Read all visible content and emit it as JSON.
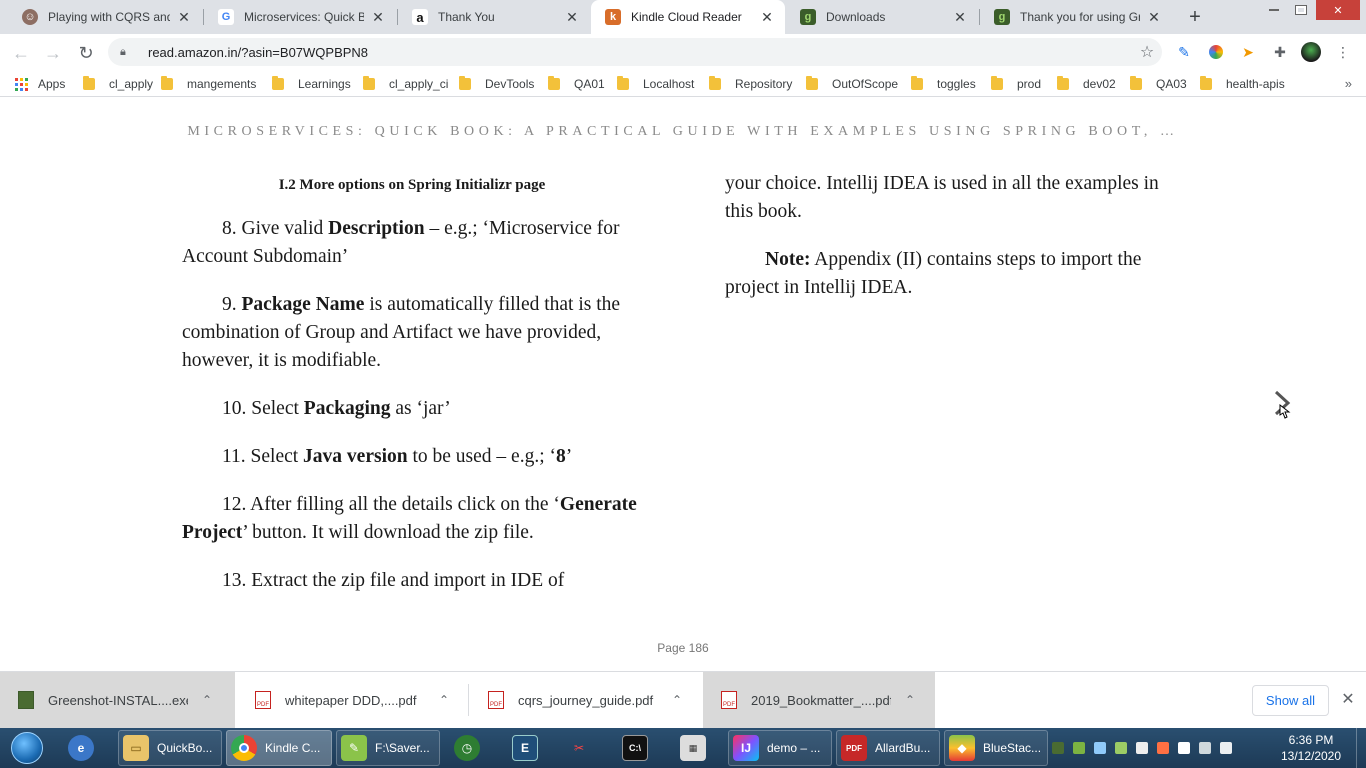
{
  "browser": {
    "tabs": [
      {
        "title": "Playing with CQRS and E",
        "icon": "avatar-icon"
      },
      {
        "title": "Microservices: Quick Boo",
        "icon": "google-icon"
      },
      {
        "title": "Thank You",
        "icon": "amazon-icon"
      },
      {
        "title": "Kindle Cloud Reader",
        "icon": "kindle-icon",
        "active": true
      },
      {
        "title": "Downloads",
        "icon": "greenshot-icon"
      },
      {
        "title": "Thank you for using Gree",
        "icon": "greenshot-icon"
      }
    ],
    "url": "read.amazon.in/?asin=B07WQPBPN8",
    "bookmarks": [
      "Apps",
      "cl_apply",
      "mangements",
      "Learnings",
      "cl_apply_ci",
      "DevTools",
      "QA01",
      "Localhost",
      "Repository",
      "OutOfScope",
      "toggles",
      "prod",
      "dev02",
      "QA03",
      "health-apis"
    ]
  },
  "reader": {
    "book_title": "MICROSERVICES: QUICK BOOK: A PRACTICAL GUIDE WITH EXAMPLES USING SPRING BOOT, …",
    "section_heading": "I.2 More options on Spring Initializr page",
    "left": {
      "p8_pre": "8. Give valid ",
      "p8_bold": "Description",
      "p8_post": " – e.g.; ‘Microservice for Account Subdomain’",
      "p9_pre": "9. ",
      "p9_bold": "Package Name",
      "p9_post": " is automatically filled that is the combination of Group and Artifact we have provided, however, it is modifiable.",
      "p10_pre": "10. Select ",
      "p10_bold": "Packaging",
      "p10_post": " as ‘jar’",
      "p11_pre": "11. Select ",
      "p11_bold": "Java version",
      "p11_mid": " to be used – e.g.; ‘",
      "p11_bold2": "8",
      "p11_post": "’",
      "p12_pre": "12. After filling all the details click on the ‘",
      "p12_bold": "Generate Project",
      "p12_post": "’ button. It will download the zip file.",
      "p13": "13. Extract the zip file and import in IDE of"
    },
    "right": {
      "p1": "your choice. Intellij IDEA is used in all the examples in this book.",
      "note_bold": "Note:",
      "note_post": " Appendix (II) contains steps to import the project in Intellij IDEA."
    },
    "page_label": "Page 186"
  },
  "downloads": {
    "items": [
      {
        "name": "Greenshot-INSTAL....exe",
        "type": "exe"
      },
      {
        "name": "whitepaper DDD,....pdf",
        "type": "pdf"
      },
      {
        "name": "cqrs_journey_guide.pdf",
        "type": "pdf"
      },
      {
        "name": "2019_Bookmatter_....pdf",
        "type": "pdf"
      }
    ],
    "show_all": "Show all"
  },
  "taskbar": {
    "items": [
      {
        "label": "",
        "icon": "explorer-icon"
      },
      {
        "label": "QuickBo...",
        "icon": "folder-icon"
      },
      {
        "label": "Kindle C...",
        "icon": "chrome-icon",
        "active": true
      },
      {
        "label": "F:\\Saver...",
        "icon": "notepadpp-icon"
      },
      {
        "label": "",
        "icon": "clock-app-icon"
      },
      {
        "label": "",
        "icon": "editor-icon"
      },
      {
        "label": "",
        "icon": "snipping-icon"
      },
      {
        "label": "",
        "icon": "cmd-icon"
      },
      {
        "label": "",
        "icon": "calc-icon"
      },
      {
        "label": "demo – ...",
        "icon": "intellij-icon"
      },
      {
        "label": "AllardBu...",
        "icon": "pdf-icon"
      },
      {
        "label": "BlueStac...",
        "icon": "bluestacks-icon"
      }
    ],
    "time": "6:36 PM",
    "date": "13/12/2020"
  }
}
